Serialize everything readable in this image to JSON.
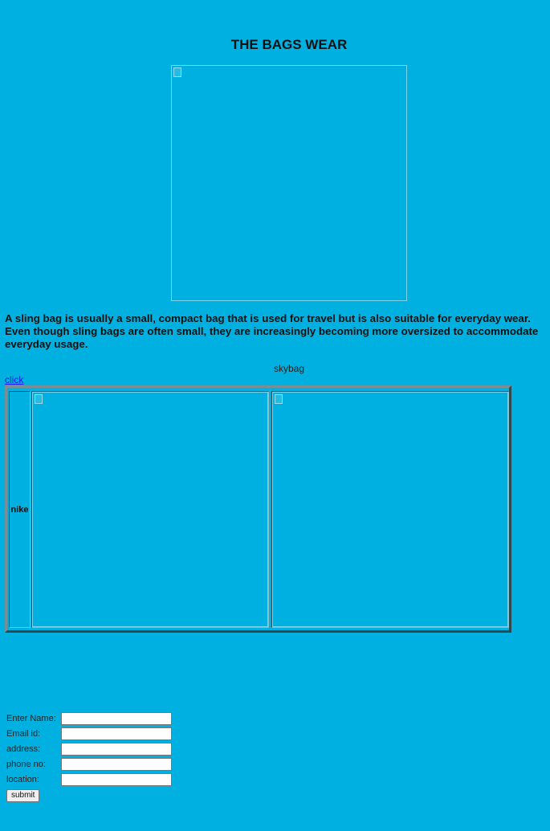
{
  "page": {
    "title": "THE BAGS WEAR",
    "description": "A sling bag is usually a small, compact bag that is used for travel but is also suitable for everyday wear. Even though sling bags are often small, they are increasingly becoming more oversized to accommodate everyday usage.",
    "caption": "skybag",
    "link_label": "click"
  },
  "table": {
    "label": "nike"
  },
  "form": {
    "fields": [
      {
        "label": "Enter Name:",
        "value": ""
      },
      {
        "label": "Email id:",
        "value": ""
      },
      {
        "label": "address:",
        "value": ""
      },
      {
        "label": "phone no:",
        "value": ""
      },
      {
        "label": "location:",
        "value": ""
      }
    ],
    "submit_label": "submit"
  },
  "colors": {
    "background": "#00b0e0",
    "link": "#1a1aee"
  },
  "icons": {
    "broken_image": "broken-image-icon"
  }
}
